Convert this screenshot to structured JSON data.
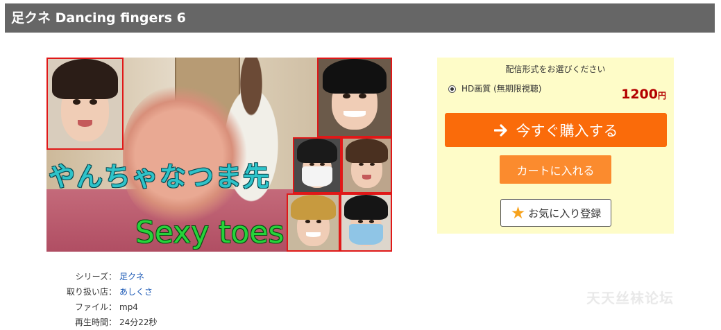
{
  "header": {
    "title": "足クネ Dancing fingers 6"
  },
  "thumbnail": {
    "text_japanese": "やんちゃなつま先",
    "text_english": "Sexy toes"
  },
  "details": [
    {
      "label": "シリーズ：",
      "value": "足クネ",
      "is_link": true
    },
    {
      "label": "取り扱い店：",
      "value": "あしくさ",
      "is_link": true
    },
    {
      "label": "ファイル：",
      "value": "mp4",
      "is_link": false
    },
    {
      "label": "再生時間：",
      "value": "24分22秒",
      "is_link": false
    }
  ],
  "purchase": {
    "heading": "配信形式をお選びください",
    "format_option": "HD画質 (無期限視聴)",
    "price": "1200",
    "currency": "円",
    "buy_now_label": "今すぐ購入する",
    "add_to_cart_label": "カートに入れる",
    "favorite_label": "お気に入り登録",
    "colors": {
      "buy_button": "#fa6b0a",
      "cart_button": "#fb8b2e",
      "price": "#b30000",
      "panel": "#fefcc8"
    }
  },
  "watermark": {
    "text": "天天丝袜论坛"
  }
}
